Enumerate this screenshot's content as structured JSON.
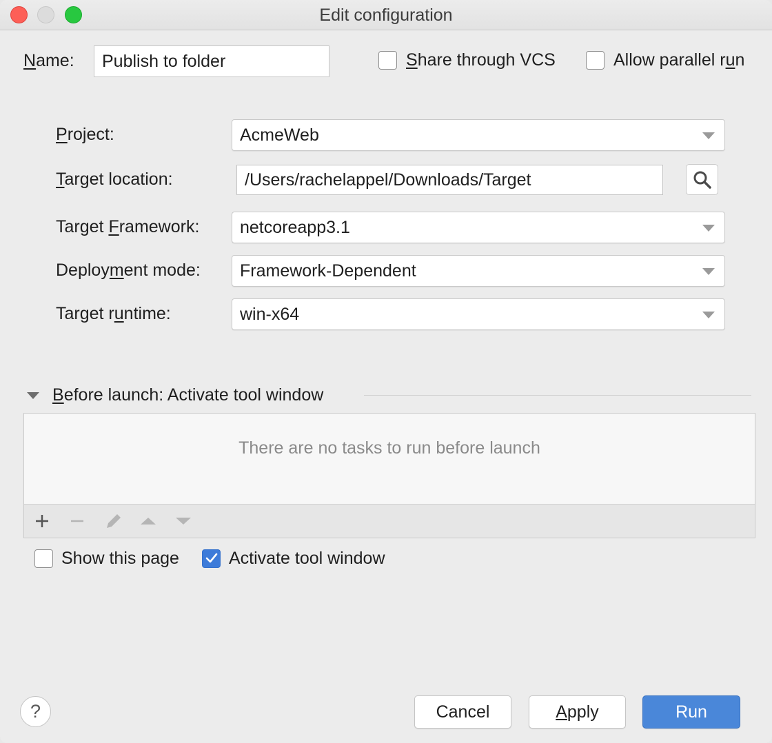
{
  "window": {
    "title": "Edit configuration"
  },
  "name_field": {
    "label": "Name:",
    "value": "Publish to folder"
  },
  "share_vcs": {
    "label": "Share through VCS",
    "checked": false
  },
  "allow_parallel": {
    "label": "Allow parallel run",
    "checked": false
  },
  "form": {
    "project": {
      "label": "Project:",
      "value": "AcmeWeb"
    },
    "target_location": {
      "label": "Target location:",
      "value": "/Users/rachelappel/Downloads/Target"
    },
    "target_framework": {
      "label": "Target Framework:",
      "value": "netcoreapp3.1"
    },
    "deployment_mode": {
      "label": "Deployment mode:",
      "value": "Framework-Dependent"
    },
    "target_runtime": {
      "label": "Target runtime:",
      "value": "win-x64"
    }
  },
  "before_launch": {
    "title": "Before launch: Activate tool window",
    "empty_text": "There are no tasks to run before launch",
    "toolbar_icons": [
      "plus-icon",
      "minus-icon",
      "pencil-icon",
      "arrow-up-icon",
      "arrow-down-icon"
    ]
  },
  "show_page": {
    "label": "Show this page",
    "checked": false
  },
  "activate_tool": {
    "label": "Activate tool window",
    "checked": true
  },
  "buttons": {
    "help": "?",
    "cancel": "Cancel",
    "apply": "Apply",
    "run": "Run"
  },
  "colors": {
    "accent": "#4a87d9",
    "close": "#fd5f57",
    "maximize": "#28c840"
  }
}
